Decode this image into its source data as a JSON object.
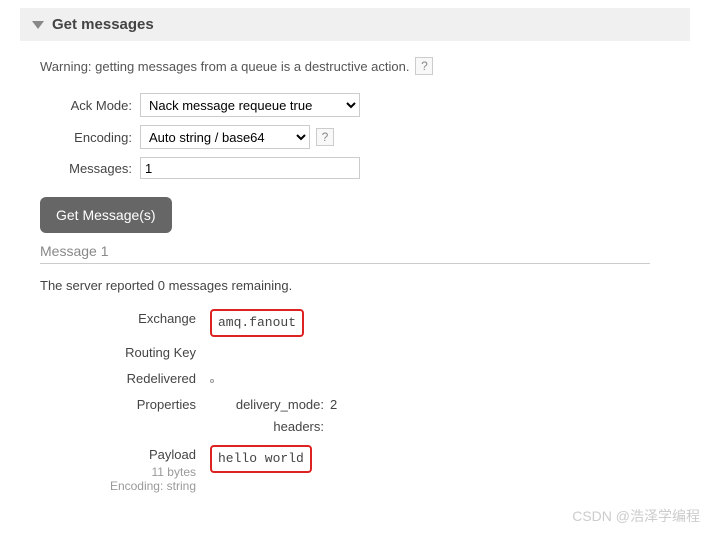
{
  "section": {
    "title": "Get messages"
  },
  "warning": {
    "text": "Warning: getting messages from a queue is a destructive action.",
    "help": "?"
  },
  "form": {
    "ack_mode": {
      "label": "Ack Mode:",
      "value": "Nack message requeue true"
    },
    "encoding": {
      "label": "Encoding:",
      "value": "Auto string / base64",
      "help": "?"
    },
    "messages": {
      "label": "Messages:",
      "value": "1"
    },
    "submit_label": "Get Message(s)"
  },
  "result": {
    "message_header": "Message 1",
    "server_report_prefix": "The server reported ",
    "server_report_count": "0",
    "server_report_suffix": " messages remaining.",
    "exchange_label": "Exchange",
    "exchange_value": "amq.fanout",
    "routing_key_label": "Routing Key",
    "routing_key_value": "",
    "redelivered_label": "Redelivered",
    "properties_label": "Properties",
    "properties": {
      "delivery_mode_key": "delivery_mode:",
      "delivery_mode_val": "2",
      "headers_key": "headers:",
      "headers_val": ""
    },
    "payload_label": "Payload",
    "payload_bytes": "11 bytes",
    "payload_encoding": "Encoding: string",
    "payload_value": "hello world"
  },
  "watermark": "CSDN @浩泽学编程"
}
